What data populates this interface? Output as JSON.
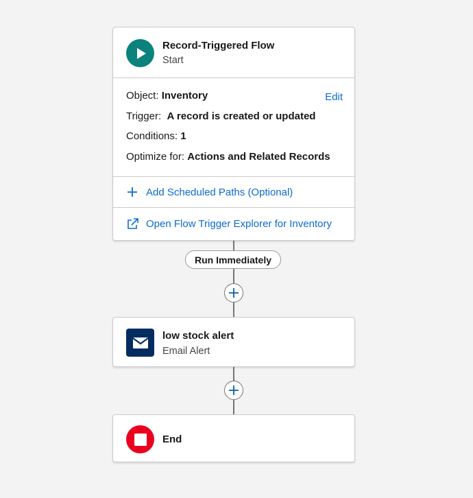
{
  "start_node": {
    "title": "Record-Triggered Flow",
    "subtitle": "Start",
    "icon": "play-icon",
    "icon_color": "#0b827c",
    "object_label": "Object:",
    "object_value": "Inventory",
    "edit_label": "Edit",
    "trigger_label": "Trigger:",
    "trigger_value": "A record is created or updated",
    "conditions_label": "Conditions:",
    "conditions_value": "1",
    "optimize_label": "Optimize for:",
    "optimize_value": "Actions and Related Records",
    "add_scheduled_paths": "Add Scheduled Paths (Optional)",
    "open_trigger_explorer": "Open Flow Trigger Explorer for Inventory"
  },
  "path_label": "Run Immediately",
  "action_node": {
    "title": "low stock alert",
    "subtitle": "Email Alert",
    "icon": "envelope-icon",
    "icon_color": "#032d60"
  },
  "end_node": {
    "title": "End",
    "icon": "stop-icon",
    "icon_color": "#ea001e"
  },
  "colors": {
    "link": "#0b6ad4",
    "canvas": "#f3f3f3",
    "connector": "#747474"
  }
}
